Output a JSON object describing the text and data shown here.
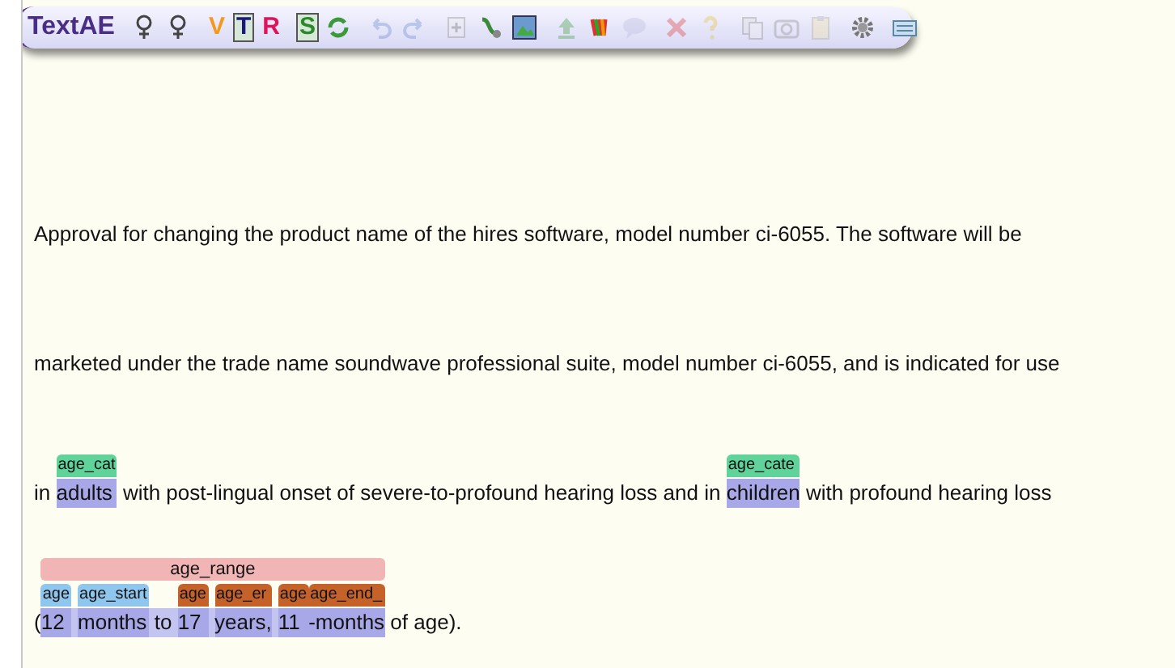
{
  "toolbar": {
    "title": "TextAE",
    "groups": [
      [
        {
          "kind": "tree",
          "disabled": false
        },
        {
          "kind": "tree",
          "disabled": false
        }
      ],
      [
        {
          "kind": "letter",
          "text": "V",
          "color": "#f39a1e",
          "disabled": false
        },
        {
          "kind": "boxed-letter",
          "text": "T",
          "color": "#1a1a7a",
          "disabled": false
        },
        {
          "kind": "letter",
          "text": "R",
          "color": "#e0135a",
          "disabled": false
        }
      ],
      [
        {
          "kind": "boxed-letter",
          "text": "S",
          "color": "#2a8a2a",
          "disabled": false
        },
        {
          "kind": "refresh",
          "disabled": false
        }
      ],
      [
        {
          "kind": "undo",
          "disabled": true
        },
        {
          "kind": "redo",
          "disabled": true
        }
      ],
      [
        {
          "kind": "add",
          "disabled": true
        },
        {
          "kind": "connector",
          "disabled": false
        },
        {
          "kind": "image",
          "disabled": false
        }
      ],
      [
        {
          "kind": "upload",
          "disabled": true
        },
        {
          "kind": "rainbow",
          "disabled": false
        },
        {
          "kind": "bubble",
          "disabled": true
        }
      ],
      [
        {
          "kind": "delete",
          "disabled": true
        },
        {
          "kind": "help",
          "disabled": true
        }
      ],
      [
        {
          "kind": "copy",
          "disabled": true
        },
        {
          "kind": "camera",
          "disabled": true
        },
        {
          "kind": "paste",
          "disabled": true
        }
      ],
      [
        {
          "kind": "gear",
          "disabled": false
        }
      ],
      [
        {
          "kind": "keyboard",
          "disabled": false
        }
      ]
    ]
  },
  "lines": [
    {
      "segments": [
        {
          "kind": "plain",
          "text": "Approval for changing the product name of the hires software, model number ci-6055. The software will be"
        }
      ]
    },
    {
      "segments": [
        {
          "kind": "plain",
          "text": "marketed under the trade name soundwave professional suite, model number ci-6055, and is indicated for use"
        }
      ]
    },
    {
      "segments": [
        {
          "kind": "plain",
          "text": "in "
        },
        {
          "kind": "entity",
          "text": "adults",
          "label": "age_cat",
          "color": "#5fd39a"
        },
        {
          "kind": "plain",
          "text": " with post-lingual onset of severe-to-profound hearing loss and in "
        },
        {
          "kind": "entity",
          "text": "children",
          "label": "age_cate",
          "color": "#5fd39a"
        },
        {
          "kind": "plain",
          "text": " with profound hearing loss"
        }
      ]
    },
    {
      "segments": [
        {
          "kind": "plain",
          "text": "("
        },
        {
          "kind": "range",
          "label": "age_range",
          "color": "#f2b5b5",
          "children": [
            {
              "kind": "entity",
              "text": "12",
              "label": "age",
              "color": "#8ec6ee"
            },
            {
              "kind": "entity",
              "text": "months",
              "label": "age_start",
              "color": "#8ec6ee"
            },
            {
              "kind": "plain",
              "text": " to "
            },
            {
              "kind": "entity",
              "text": "17",
              "label": "age",
              "color": "#c5622a"
            },
            {
              "kind": "entity",
              "text": "years,",
              "label": "age_er",
              "color": "#c5622a"
            },
            {
              "kind": "entity",
              "text": "11",
              "label": "age",
              "color": "#c5622a"
            },
            {
              "kind": "entity",
              "text": "-months",
              "label": "age_end_",
              "color": "#c5622a",
              "joined": true
            }
          ]
        },
        {
          "kind": "plain",
          "text": " of age)."
        }
      ]
    }
  ]
}
